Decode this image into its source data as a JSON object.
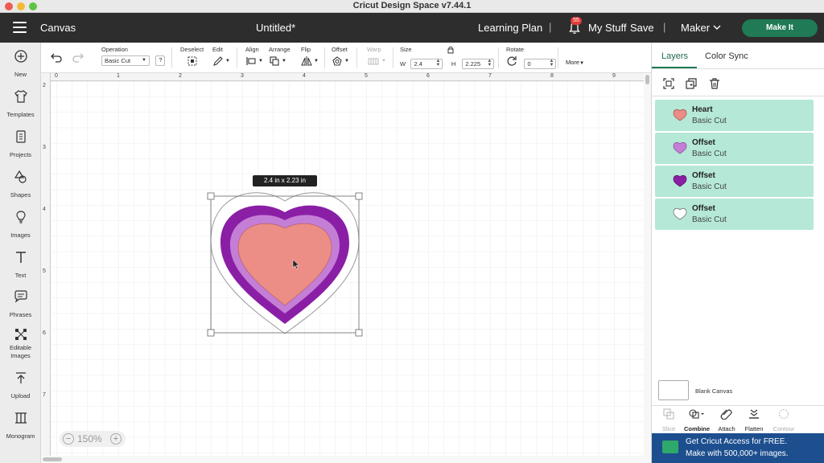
{
  "window": {
    "title": "Cricut Design Space  v7.44.1"
  },
  "header": {
    "canvas_label": "Canvas",
    "doc_title": "Untitled*",
    "learning_plan": "Learning Plan",
    "separator": "|",
    "notification_count": "55",
    "my_stuff": "My Stuff",
    "save": "Save",
    "machine": "Maker",
    "make_it": "Make It"
  },
  "sidebar": {
    "items": [
      {
        "label": "New",
        "icon": "plus-circle-icon"
      },
      {
        "label": "Templates",
        "icon": "shirt-icon"
      },
      {
        "label": "Projects",
        "icon": "projects-icon"
      },
      {
        "label": "Shapes",
        "icon": "shapes-icon"
      },
      {
        "label": "Images",
        "icon": "lightbulb-icon"
      },
      {
        "label": "Text",
        "icon": "text-icon"
      },
      {
        "label": "Phrases",
        "icon": "speech-bubble-icon"
      },
      {
        "label": "Editable Images",
        "icon": "editable-images-icon"
      },
      {
        "label": "Upload",
        "icon": "upload-icon"
      },
      {
        "label": "Monogram",
        "icon": "monogram-icon"
      }
    ]
  },
  "toolbar": {
    "operation_label": "Operation",
    "operation_value": "Basic Cut",
    "help": "?",
    "deselect": "Deselect",
    "edit": "Edit",
    "align": "Align",
    "arrange": "Arrange",
    "flip": "Flip",
    "offset": "Offset",
    "warp": "Warp",
    "size_label": "Size",
    "w_letter": "W",
    "w_value": "2.4",
    "h_letter": "H",
    "h_value": "2.225",
    "rotate_label": "Rotate",
    "rotate_value": "0",
    "more": "More"
  },
  "rulers": {
    "top": [
      "0",
      "1",
      "2",
      "3",
      "4",
      "5",
      "6",
      "7",
      "8",
      "9"
    ],
    "left": [
      "2",
      "3",
      "4",
      "5",
      "6",
      "7"
    ]
  },
  "canvas": {
    "size_tooltip": "2.4  in x 2.23  in",
    "zoom": "150%",
    "colors": {
      "outer_offset": "#ffffff",
      "dark_offset": "#8a1fa6",
      "light_offset": "#c47ed6",
      "heart": "#ec8e86"
    }
  },
  "right_panel": {
    "tab_layers": "Layers",
    "tab_color_sync": "Color Sync",
    "layers": [
      {
        "name": "Heart",
        "operation": "Basic Cut",
        "color": "#ec8e86"
      },
      {
        "name": "Offset",
        "operation": "Basic Cut",
        "color": "#c47ed6"
      },
      {
        "name": "Offset",
        "operation": "Basic Cut",
        "color": "#8a1fa6"
      },
      {
        "name": "Offset",
        "operation": "Basic Cut",
        "color": "#ffffff"
      }
    ],
    "blank_canvas": "Blank Canvas",
    "bottom_tools": {
      "slice": "Slice",
      "combine": "Combine",
      "attach": "Attach",
      "flatten": "Flatten",
      "contour": "Contour"
    },
    "promo_line1": "Get Cricut Access for FREE.",
    "promo_line2": "Make with 500,000+ images."
  }
}
